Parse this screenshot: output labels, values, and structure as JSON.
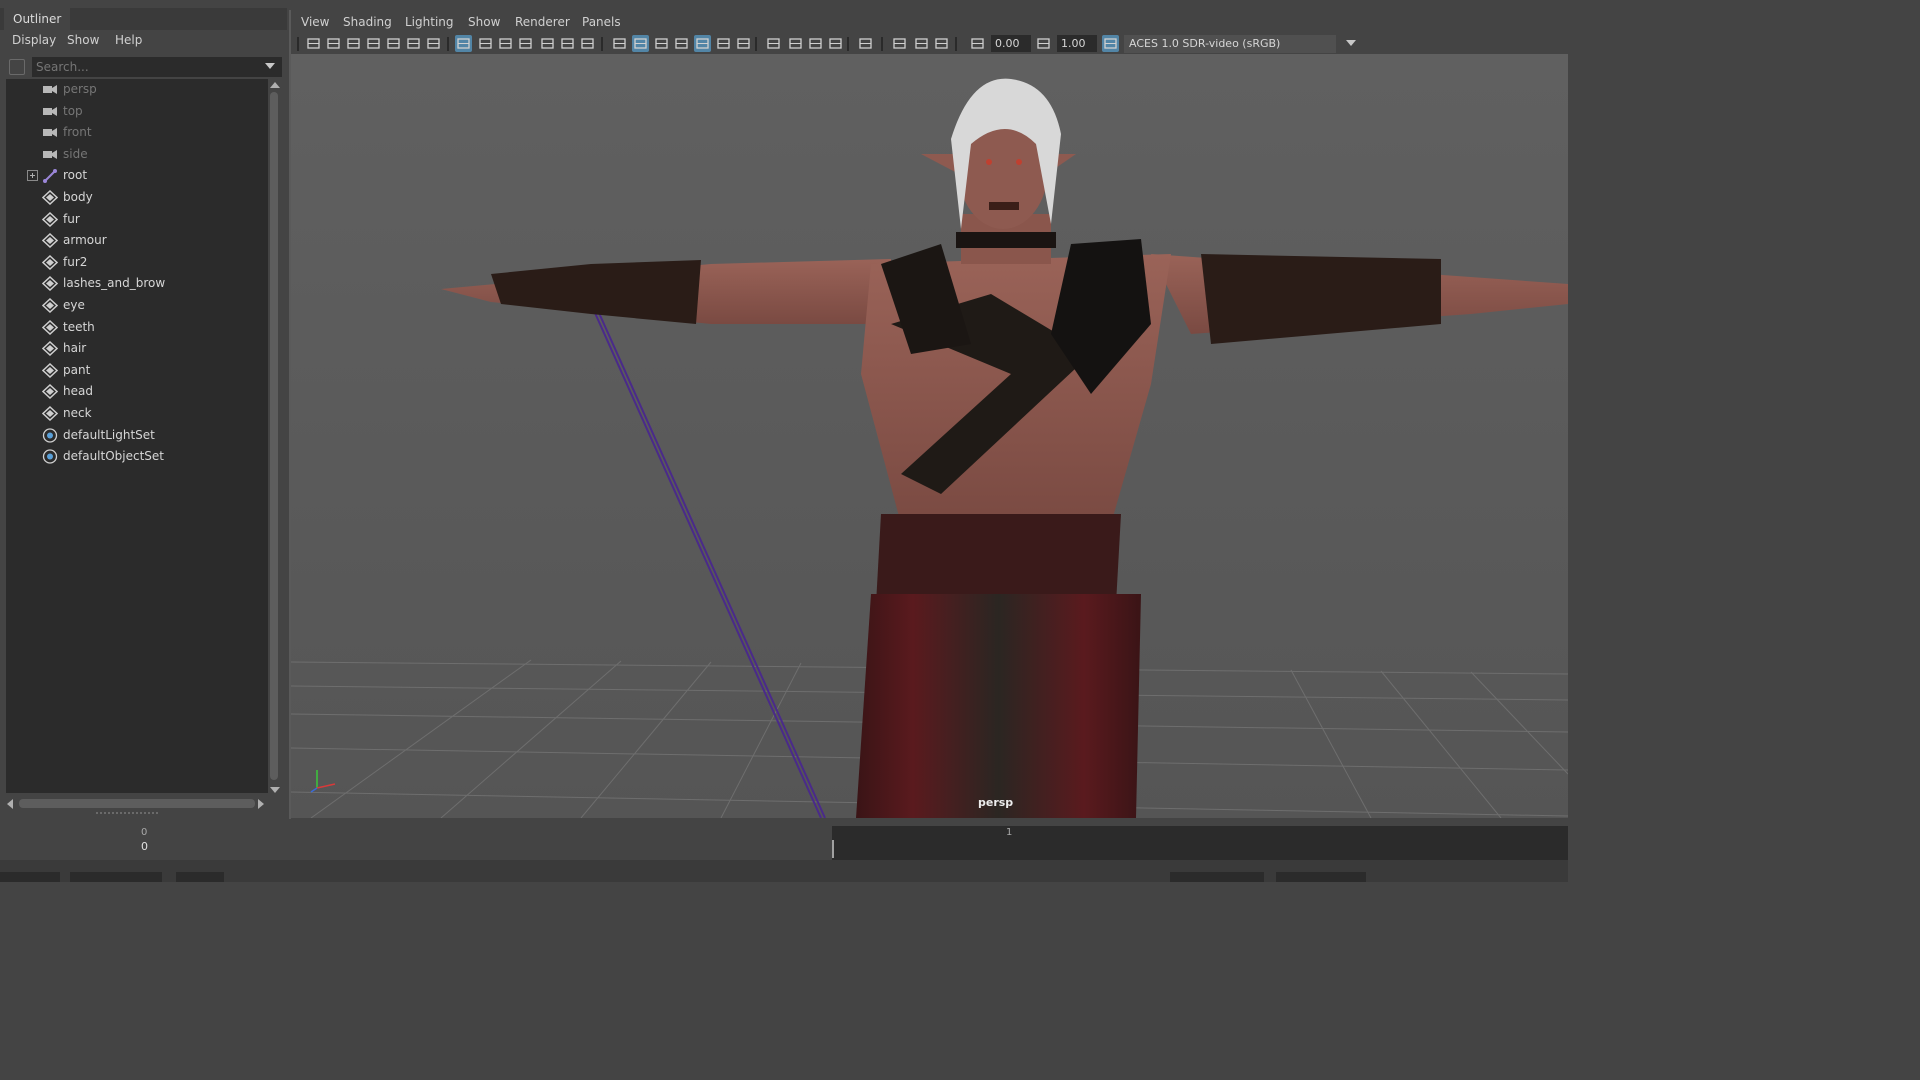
{
  "outliner": {
    "tab_label": "Outliner",
    "menus": [
      "Display",
      "Show",
      "Help"
    ],
    "search_placeholder": "Search...",
    "items": [
      {
        "label": "persp",
        "type": "camera",
        "dim": true
      },
      {
        "label": "top",
        "type": "camera",
        "dim": true
      },
      {
        "label": "front",
        "type": "camera",
        "dim": true
      },
      {
        "label": "side",
        "type": "camera",
        "dim": true
      },
      {
        "label": "root",
        "type": "joint",
        "dim": false,
        "expandable": true
      },
      {
        "label": "body",
        "type": "mesh",
        "dim": false
      },
      {
        "label": "fur",
        "type": "mesh",
        "dim": false
      },
      {
        "label": "armour",
        "type": "mesh",
        "dim": false
      },
      {
        "label": "fur2",
        "type": "mesh",
        "dim": false
      },
      {
        "label": "lashes_and_brow",
        "type": "mesh",
        "dim": false
      },
      {
        "label": "eye",
        "type": "mesh",
        "dim": false
      },
      {
        "label": "teeth",
        "type": "mesh",
        "dim": false
      },
      {
        "label": "hair",
        "type": "mesh",
        "dim": false
      },
      {
        "label": "pant",
        "type": "mesh",
        "dim": false
      },
      {
        "label": "head",
        "type": "mesh",
        "dim": false
      },
      {
        "label": "neck",
        "type": "mesh",
        "dim": false
      },
      {
        "label": "defaultLightSet",
        "type": "set",
        "dim": false
      },
      {
        "label": "defaultObjectSet",
        "type": "set",
        "dim": false
      }
    ]
  },
  "viewport": {
    "menus": [
      "View",
      "Shading",
      "Lighting",
      "Show",
      "Renderer",
      "Panels"
    ],
    "exposure_value": "0.00",
    "gamma_value": "1.00",
    "color_space": "ACES 1.0 SDR-video (sRGB)",
    "camera_label": "persp",
    "accent_color": "#5285a6"
  },
  "timeline": {
    "start_tick": "0",
    "end_tick": "1",
    "current_frame": "0"
  }
}
